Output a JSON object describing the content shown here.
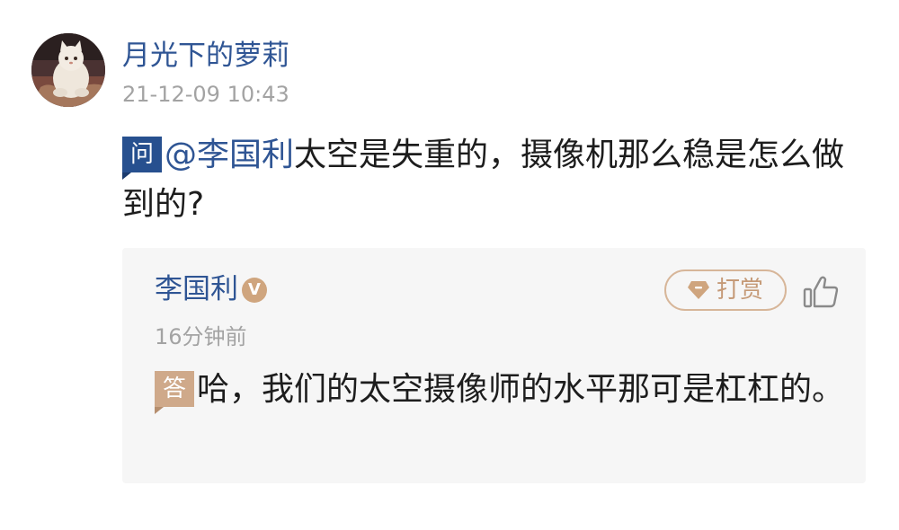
{
  "question": {
    "user": {
      "name": "月光下的萝莉",
      "avatar": "cat-photo-avatar"
    },
    "timestamp": "21-12-09 10:43",
    "tag": "问",
    "mention": "@李国利",
    "text": "太空是失重的，摄像机那么稳是怎么做到的?"
  },
  "answer": {
    "author": "李国利",
    "verified_badge": "V",
    "tip_button_label": "打赏",
    "tip_icon": "diamond-tip-icon",
    "like_icon": "thumbs-up-icon",
    "time": "16分钟前",
    "tag": "答",
    "text": "哈，我们的太空摄像师的水平那可是杠杠的。"
  },
  "colors": {
    "link_blue": "#2f5594",
    "question_tag": "#27508f",
    "answer_tag": "#cfa98a",
    "gold_accent": "#cfa57e",
    "card_background": "#f6f6f6",
    "muted_text": "#a3a3a3"
  }
}
